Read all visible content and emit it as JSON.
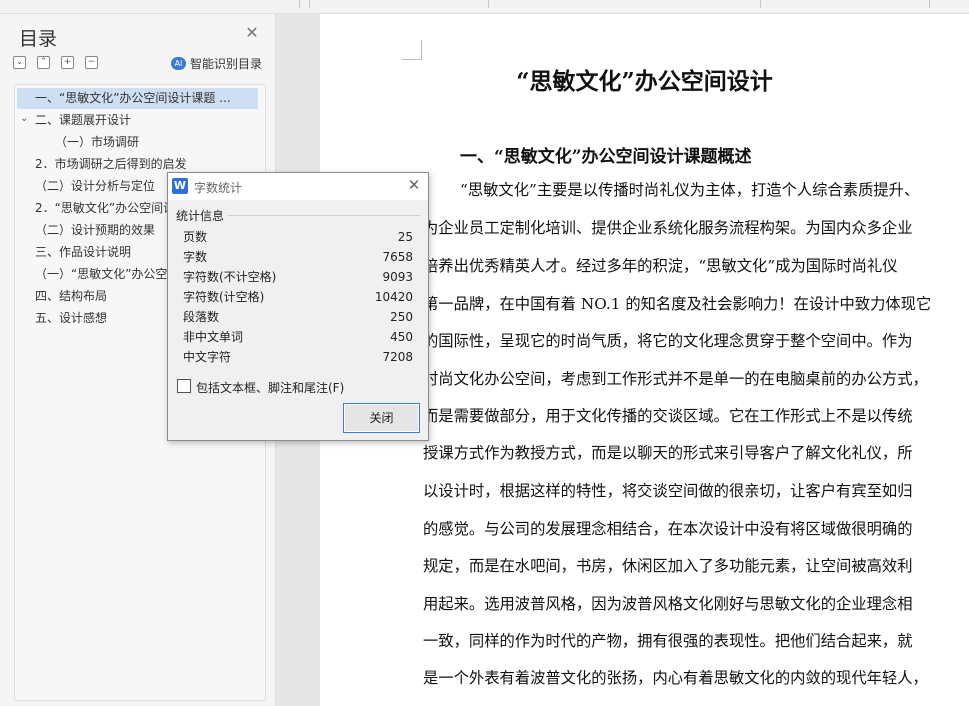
{
  "sidebar": {
    "title": "目录",
    "smart_toc_label": "智能识别目录",
    "tools": [
      "⌄",
      "⌃",
      "+",
      "−"
    ],
    "items": [
      {
        "label": "一、“思敏文化”办公空间设计课题 ...",
        "selected": true
      },
      {
        "label": "二、课题展开设计",
        "expanded": true
      },
      {
        "label": "（一）市场调研"
      },
      {
        "label": "2．市场调研之后得到的启发"
      },
      {
        "label": "（二）设计分析与定位"
      },
      {
        "label": "2．“思敏文化”办公空间设计"
      },
      {
        "label": "（二）设计预期的效果"
      },
      {
        "label": "三、作品设计说明"
      },
      {
        "label": "（一）“思敏文化”办公空间设计"
      },
      {
        "label": "四、结构布局"
      },
      {
        "label": "五、设计感想"
      }
    ]
  },
  "document": {
    "title": "“思敏文化”办公空间设计",
    "heading": "一、“思敏文化”办公空间设计课题概述",
    "lines": [
      "“思敏文化”主要是以传播时尚礼仪为主体，打造个人综合素质提升、",
      "为企业员工定制化培训、提供企业系统化服务流程构架。为国内众多企业",
      "培养出优秀精英人才。经过多年的积淀，“思敏文化”成为国际时尚礼仪",
      "第一品牌，在中国有着 NO.1 的知名度及社会影响力！在设计中致力体现它",
      "的国际性，呈现它的时尚气质，将它的文化理念贯穿于整个空间中。作为",
      "时尚文化办公空间，考虑到工作形式并不是单一的在电脑桌前的办公方式，",
      "而是需要做部分，用于文化传播的交谈区域。它在工作形式上不是以传统",
      "授课方式作为教授方式，而是以聊天的形式来引导客户了解文化礼仪，所",
      "以设计时，根据这样的特性，将交谈空间做的很亲切，让客户有宾至如归",
      "的感觉。与公司的发展理念相结合，在本次设计中没有将区域做很明确的",
      "规定，而是在水吧间，书房，休闲区加入了多功能元素，让空间被高效利",
      "用起来。选用波普风格，因为波普风格文化刚好与思敏文化的企业理念相",
      "一致，同样的作为时代的产物，拥有很强的表现性。把他们结合起来，就",
      "是一个外表有着波普文化的张扬，内心有着思敏文化的内敛的现代年轻人，"
    ]
  },
  "dialog": {
    "logo": "W",
    "title": "字数统计",
    "section": "统计信息",
    "stats": [
      {
        "label": "页数",
        "value": "25"
      },
      {
        "label": "字数",
        "value": "7658"
      },
      {
        "label": "字符数(不计空格)",
        "value": "9093"
      },
      {
        "label": "字符数(计空格)",
        "value": "10420"
      },
      {
        "label": "段落数",
        "value": "250"
      },
      {
        "label": "非中文单词",
        "value": "450"
      },
      {
        "label": "中文字符",
        "value": "7208"
      }
    ],
    "checkbox_label": "包括文本框、脚注和尾注(F)",
    "close_button": "关闭"
  },
  "colors": {
    "selection": "#cfdff3",
    "accent": "#3a7bd5"
  }
}
